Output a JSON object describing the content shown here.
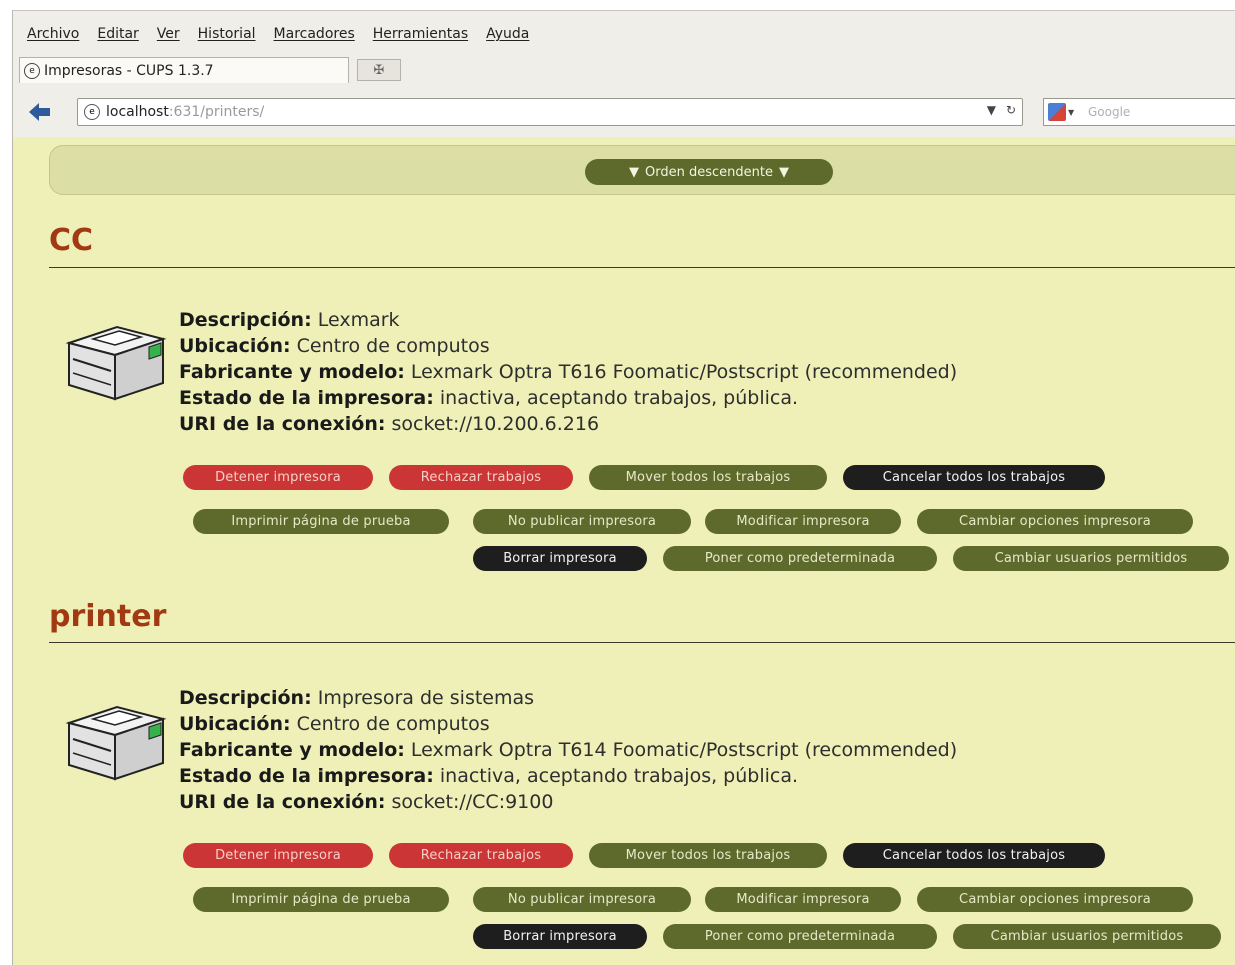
{
  "menubar": {
    "items": [
      "Archivo",
      "Editar",
      "Ver",
      "Historial",
      "Marcadores",
      "Herramientas",
      "Ayuda"
    ]
  },
  "tab": {
    "title": "Impresoras - CUPS 1.3.7"
  },
  "navbar": {
    "url_host": "localhost",
    "url_path": ":631/printers/",
    "search_placeholder": "Google"
  },
  "sort": {
    "label": "Orden descendente"
  },
  "colors": {
    "page_background": "#eef0b7",
    "heading": "#a13a12",
    "button_red": "#cc3535",
    "button_olive": "#5e6a2b",
    "button_black": "#1e1e1e"
  },
  "field_labels": {
    "description": "Descripción:",
    "location": "Ubicación:",
    "make_model": "Fabricante y modelo:",
    "state": "Estado de la impresora:",
    "uri": "URI de la conexión:"
  },
  "printers": [
    {
      "name": "CC",
      "description": "Lexmark",
      "location": "Centro de computos",
      "make_model": "Lexmark Optra T616 Foomatic/Postscript (recommended)",
      "state": "inactiva, aceptando trabajos, pública.",
      "uri": "socket://10.200.6.216",
      "actions": {
        "stop": "Detener impresora",
        "reject": "Rechazar trabajos",
        "move_all": "Mover todos los trabajos",
        "cancel_all": "Cancelar todos los trabajos",
        "print_test": "Imprimir página de prueba",
        "unpublish": "No publicar impresora",
        "modify": "Modificar impresora",
        "set_options": "Cambiar opciones impresora",
        "delete": "Borrar impresora",
        "set_default": "Poner como predeterminada",
        "allowed_users": "Cambiar usuarios permitidos"
      }
    },
    {
      "name": "printer",
      "description": "Impresora de sistemas",
      "location": "Centro de computos",
      "make_model": "Lexmark Optra T614 Foomatic/Postscript (recommended)",
      "state": "inactiva, aceptando trabajos, pública.",
      "uri": "socket://CC:9100",
      "actions": {
        "stop": "Detener impresora",
        "reject": "Rechazar trabajos",
        "move_all": "Mover todos los trabajos",
        "cancel_all": "Cancelar todos los trabajos",
        "print_test": "Imprimir página de prueba",
        "unpublish": "No publicar impresora",
        "modify": "Modificar impresora",
        "set_options": "Cambiar opciones impresora",
        "delete": "Borrar impresora",
        "set_default": "Poner como predeterminada",
        "allowed_users": "Cambiar usuarios permitidos"
      }
    }
  ]
}
